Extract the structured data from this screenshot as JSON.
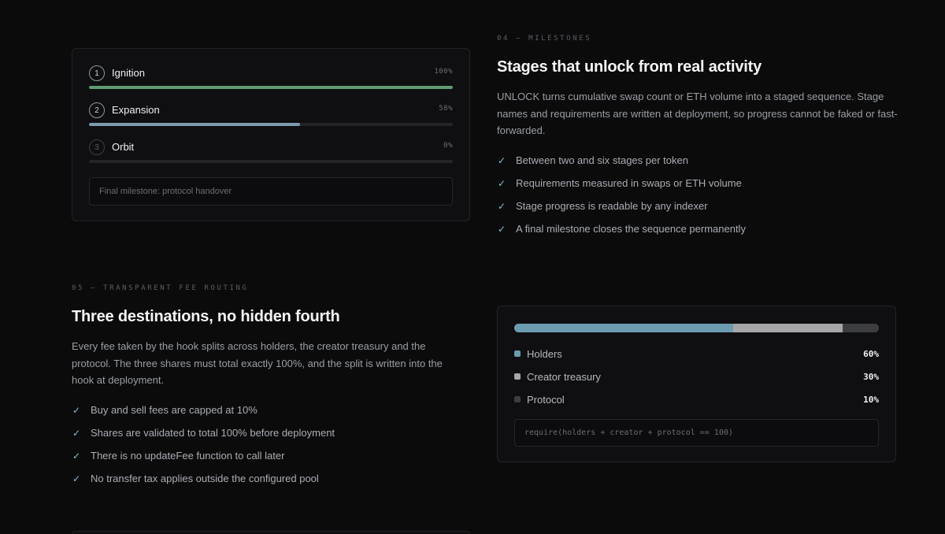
{
  "milestones": {
    "eyebrow": "04 — MILESTONES",
    "heading": "Stages that unlock from real activity",
    "paragraph": "UNLOCK turns cumulative swap count or ETH volume into a staged sequence. Stage names and requirements are written at deployment, so progress cannot be faked or fast-forwarded.",
    "checklist": [
      "Between two and six stages per token",
      "Requirements measured in swaps or ETH volume",
      "Stage progress is readable by any indexer",
      "A final milestone closes the sequence permanently"
    ],
    "card": {
      "stages": [
        {
          "number": "1",
          "name": "Ignition",
          "percent_label": "100%",
          "progress": 1.0,
          "color": "#5f9b72"
        },
        {
          "number": "2",
          "name": "Expansion",
          "percent_label": "58%",
          "progress": 0.58,
          "color": "#7d9bb0"
        },
        {
          "number": "3",
          "name": "Orbit",
          "percent_label": "0%",
          "progress": 0.0,
          "color": "#7d9bb0"
        }
      ],
      "final_milestone": "Final milestone: protocol handover"
    }
  },
  "fees": {
    "eyebrow": "05 — TRANSPARENT FEE ROUTING",
    "heading": "Three destinations, no hidden fourth",
    "paragraph": "Every fee taken by the hook splits across holders, the creator treasury and the protocol. The three shares must total exactly 100%, and the split is written into the hook at deployment.",
    "checklist": [
      "Buy and sell fees are capped at 10%",
      "Shares are validated to total 100% before deployment",
      "There is no updateFee function to call later",
      "No transfer tax applies outside the configured pool"
    ],
    "card": {
      "splits": [
        {
          "name": "Holders",
          "value_label": "60%",
          "share": 0.6,
          "color": "#6a9bb1"
        },
        {
          "name": "Creator treasury",
          "value_label": "30%",
          "share": 0.3,
          "color": "#a4a6a8"
        },
        {
          "name": "Protocol",
          "value_label": "10%",
          "share": 0.1,
          "color": "#3c3d40"
        }
      ],
      "code": "require(holders + creator + protocol == 100)"
    }
  },
  "colors": {
    "background": "#0b0b0c",
    "accent_check": "#86bfd4"
  },
  "icons": {
    "check": "check-icon"
  }
}
